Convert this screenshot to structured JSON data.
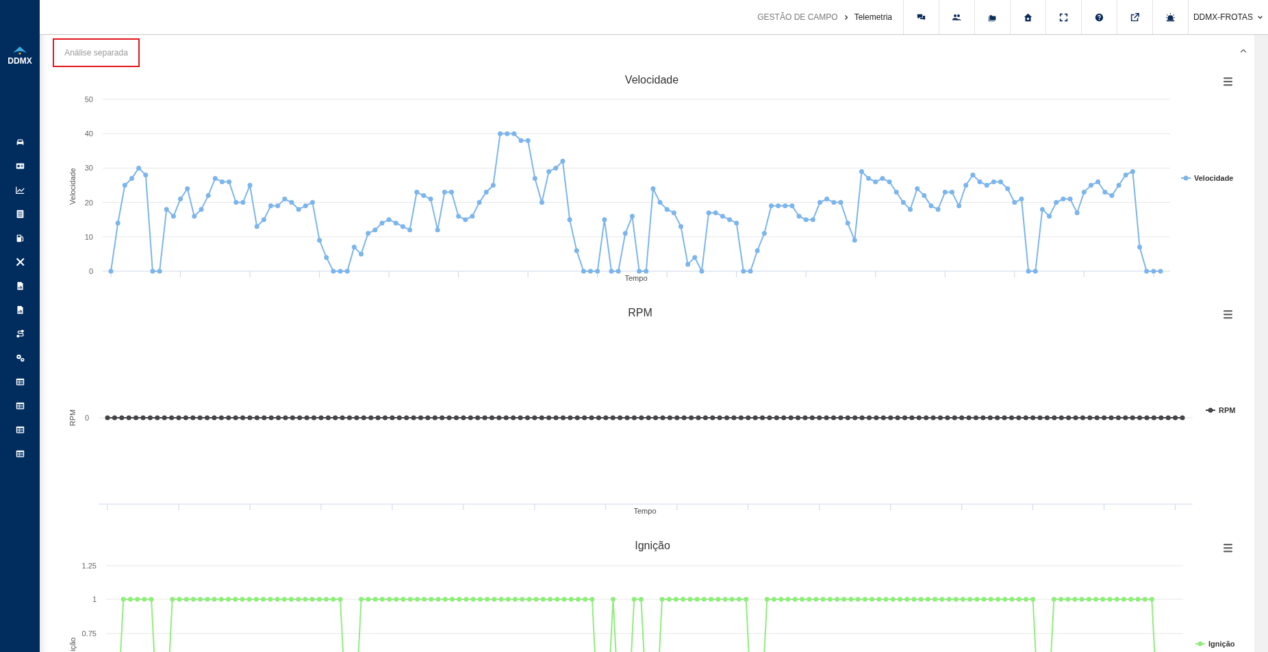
{
  "sidebar": {
    "logo": "DDMX"
  },
  "topbar": {
    "breadcrumb": [
      {
        "label": "GESTÃO DE CAMPO",
        "current": false
      },
      {
        "label": "Telemetria",
        "current": true
      }
    ],
    "account": "DDMX-FROTAS"
  },
  "section": {
    "title": "Análise separada",
    "expanded": true
  },
  "charts": [
    {
      "chart_data": {
        "type": "line",
        "title": "Velocidade",
        "xlabel": "Tempo",
        "ylabel": "Velocidade",
        "ylim": [
          0,
          50
        ],
        "yticks": [
          0,
          10,
          20,
          30,
          40,
          50
        ],
        "grid": true,
        "series": [
          {
            "name": "Velocidade",
            "color": "#7cb5ec",
            "marker": true,
            "values": [
              0,
              14,
              25,
              27,
              30,
              28,
              0,
              0,
              18,
              16,
              21,
              24,
              16,
              18,
              22,
              27,
              26,
              26,
              20,
              20,
              25,
              13,
              15,
              19,
              19,
              21,
              20,
              18,
              19,
              20,
              9,
              4,
              0,
              0,
              0,
              7,
              5,
              11,
              12,
              14,
              15,
              14,
              13,
              12,
              23,
              22,
              21,
              12,
              23,
              23,
              16,
              15,
              16,
              20,
              23,
              25,
              40,
              40,
              40,
              38,
              38,
              27,
              20,
              29,
              30,
              32,
              15,
              6,
              0,
              0,
              0,
              15,
              0,
              0,
              11,
              16,
              0,
              0,
              24,
              20,
              18,
              17,
              13,
              2,
              4,
              0,
              17,
              17,
              16,
              15,
              14,
              0,
              0,
              6,
              11,
              19,
              19,
              19,
              19,
              16,
              15,
              15,
              20,
              21,
              20,
              20,
              14,
              9,
              29,
              27,
              26,
              27,
              26,
              23,
              20,
              18,
              24,
              22,
              19,
              18,
              23,
              23,
              19,
              25,
              28,
              26,
              25,
              26,
              26,
              24,
              20,
              21,
              0,
              0,
              18,
              16,
              20,
              21,
              21,
              17,
              23,
              25,
              26,
              23,
              22,
              25,
              28,
              29,
              7,
              0,
              0,
              0
            ]
          }
        ]
      }
    },
    {
      "title": "RPM",
      "xlabel": "Tempo",
      "ylabel": "RPM",
      "ytick_labels": [
        "0"
      ],
      "legend": [
        {
          "name": "RPM",
          "color": "#434348"
        }
      ]
    },
    {
      "title": "Ignição",
      "ylabel": "ição",
      "ytick_labels": [
        "1.25",
        "1",
        "0.75"
      ],
      "legend": [
        {
          "name": "Ignição",
          "color": "#90ed7d"
        }
      ]
    }
  ]
}
